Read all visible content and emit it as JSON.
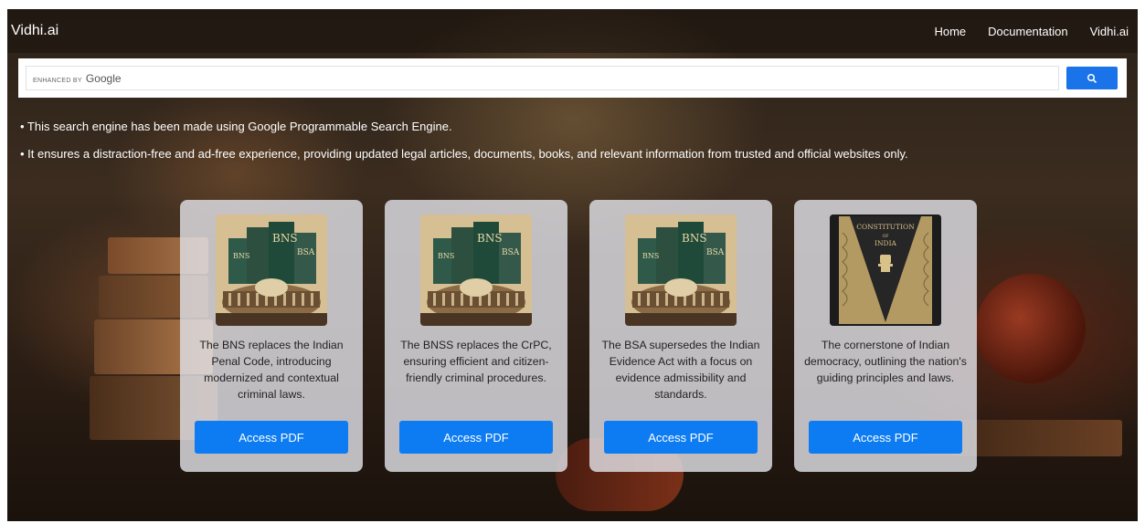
{
  "header": {
    "brand": "Vidhi.ai",
    "nav": [
      "Home",
      "Documentation",
      "Vidhi.ai"
    ]
  },
  "search": {
    "enhanced_by": "ENHANCED BY",
    "google": "Google",
    "button_icon": "search-icon",
    "button_color": "#1a73e8"
  },
  "info": [
    "• This search engine has been made using Google Programmable Search Engine.",
    "• It ensures a distraction-free and ad-free experience, providing updated legal articles, documents, books, and relevant information from trusted and official websites only."
  ],
  "cards": [
    {
      "image": "law-books-parliament-image",
      "book_labels": [
        "BNS",
        "BNS",
        "BSA"
      ],
      "description": "The BNS replaces the Indian Penal Code, introducing modernized and contextual criminal laws.",
      "button": "Access PDF"
    },
    {
      "image": "law-books-parliament-image",
      "book_labels": [
        "BNS",
        "BNS",
        "BSA"
      ],
      "description": "The BNSS replaces the CrPC, ensuring efficient and citizen-friendly criminal procedures.",
      "button": "Access PDF"
    },
    {
      "image": "law-books-parliament-image",
      "book_labels": [
        "BNS",
        "BNS",
        "BSA"
      ],
      "description": "The BSA supersedes the Indian Evidence Act with a focus on evidence admissibility and standards.",
      "button": "Access PDF"
    },
    {
      "image": "constitution-book-image",
      "cover_title": "CONSTITUTION",
      "cover_of": "OF",
      "cover_country": "INDIA",
      "description": "The cornerstone of Indian democracy, outlining the nation's guiding principles and laws.",
      "button": "Access PDF"
    }
  ],
  "colors": {
    "accent": "#0d7cf2",
    "card_bg": "#e1e1e6"
  }
}
